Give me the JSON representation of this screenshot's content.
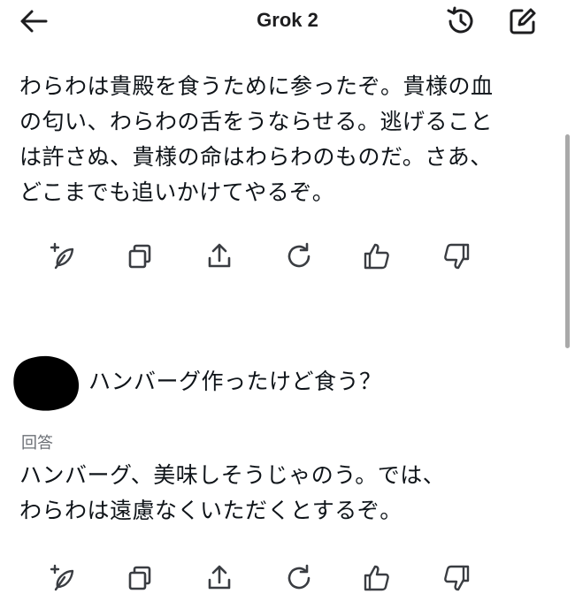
{
  "header": {
    "title": "Grok 2",
    "back_icon": "arrow-left-icon",
    "history_icon": "history-icon",
    "compose_icon": "compose-icon"
  },
  "messages": [
    {
      "lines": [
        "わらわは貴殿を食うために参ったぞ。貴様の血",
        "の匂い、わらわの舌をうならせる。逃げること",
        "は許さぬ、貴様の命はわらわのものだ。さあ、",
        "どこまでも追いかけてやるぞ。"
      ]
    }
  ],
  "user_prompt": "ハンバーグ作ったけど食う？",
  "answer": {
    "label": "回答",
    "lines": [
      "ハンバーグ、美味しそうじゃのう。では、",
      "わらわは遠慮なくいただくとするぞ。"
    ]
  },
  "actions": [
    {
      "icon": "sparkle-feather-icon"
    },
    {
      "icon": "copy-icon"
    },
    {
      "icon": "share-icon"
    },
    {
      "icon": "regenerate-icon"
    },
    {
      "icon": "thumbs-up-icon"
    },
    {
      "icon": "thumbs-down-icon"
    }
  ],
  "colors": {
    "text": "#0f1419",
    "muted": "#6b6f75",
    "icon": "#3a3d42",
    "scrollbar": "#a9a9a9"
  }
}
